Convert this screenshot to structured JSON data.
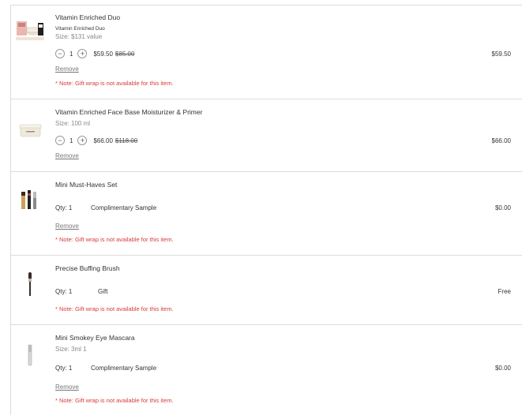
{
  "items": [
    {
      "title": "Vitamin Enriched Duo",
      "subtitle": "Vitamin Enriched Duo",
      "size": "Size: $131 value",
      "qty": "1",
      "price": "$59.50",
      "original_price": "$85.00",
      "remove_label": "Remove",
      "note": "* Note: Gift wrap is not available for this item.",
      "total": "$59.50",
      "thumb_icon": "product-duo-icon"
    },
    {
      "title": "Vitamin Enriched Face Base Moisturizer & Primer",
      "size": "Size: 100 ml",
      "qty": "1",
      "price": "$66.00",
      "original_price": "$118.00",
      "remove_label": "Remove",
      "total": "$66.00",
      "thumb_icon": "product-jar-icon"
    },
    {
      "title": "Mini Must-Haves Set",
      "qty_label": "Qty: 1",
      "type_label": "Complimentary Sample",
      "remove_label": "Remove",
      "note": "* Note: Gift wrap is not available for this item.",
      "total": "$0.00",
      "thumb_icon": "product-minis-icon"
    },
    {
      "title": "Precise Buffing Brush",
      "qty_label": "Qty: 1",
      "type_label": "Gift",
      "note": "* Note: Gift wrap is not available for this item.",
      "total": "Free",
      "thumb_icon": "product-brush-icon"
    },
    {
      "title": "Mini Smokey Eye Mascara",
      "size": "Size: 3ml 1",
      "qty_label": "Qty: 1",
      "type_label": "Complimentary Sample",
      "remove_label": "Remove",
      "note": "* Note: Gift wrap is not available for this item.",
      "total": "$0.00",
      "thumb_icon": "product-mascara-icon"
    }
  ],
  "controls": {
    "minus": "−",
    "plus": "+"
  },
  "colors": {
    "note": "#d83a3a",
    "divider": "#dcdcdc",
    "muted": "#888888"
  }
}
